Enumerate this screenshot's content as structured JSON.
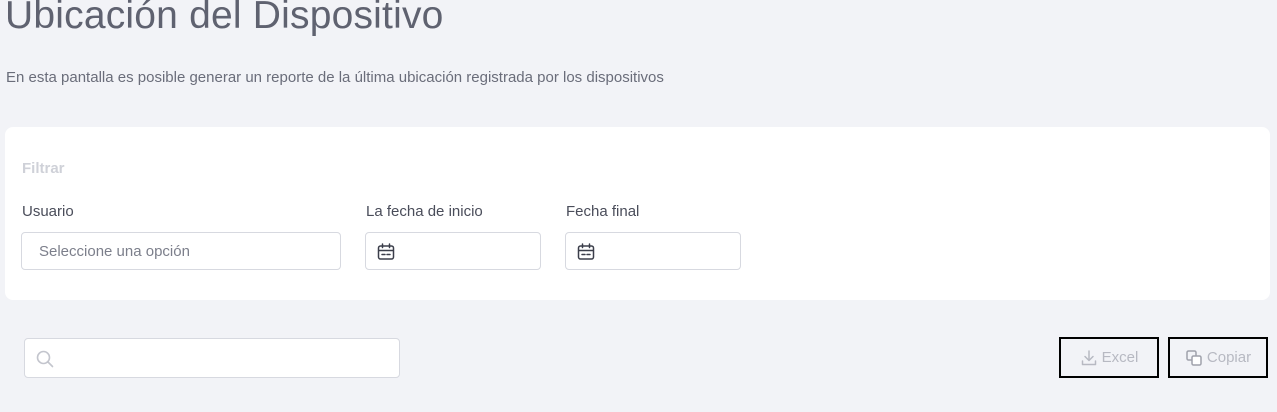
{
  "header": {
    "title": "Ubicación del Dispositivo",
    "description": "En esta pantalla es posible generar un reporte de la última ubicación registrada por los dispositivos"
  },
  "filter": {
    "title": "Filtrar",
    "user": {
      "label": "Usuario",
      "placeholder": "Seleccione una opción"
    },
    "start_date": {
      "label": "La fecha de inicio",
      "value": "",
      "icon": "calendar-icon"
    },
    "end_date": {
      "label": "Fecha final",
      "value": "",
      "icon": "calendar-icon"
    }
  },
  "toolbar": {
    "search": {
      "value": "",
      "icon": "search-icon"
    },
    "excel_label": "Excel",
    "excel_icon": "download-icon",
    "copy_label": "Copiar",
    "copy_icon": "copy-icon"
  },
  "colors": {
    "background": "#f2f3f7",
    "card": "#ffffff",
    "muted_text": "#b7b9c2",
    "border": "#d7d9e0"
  }
}
